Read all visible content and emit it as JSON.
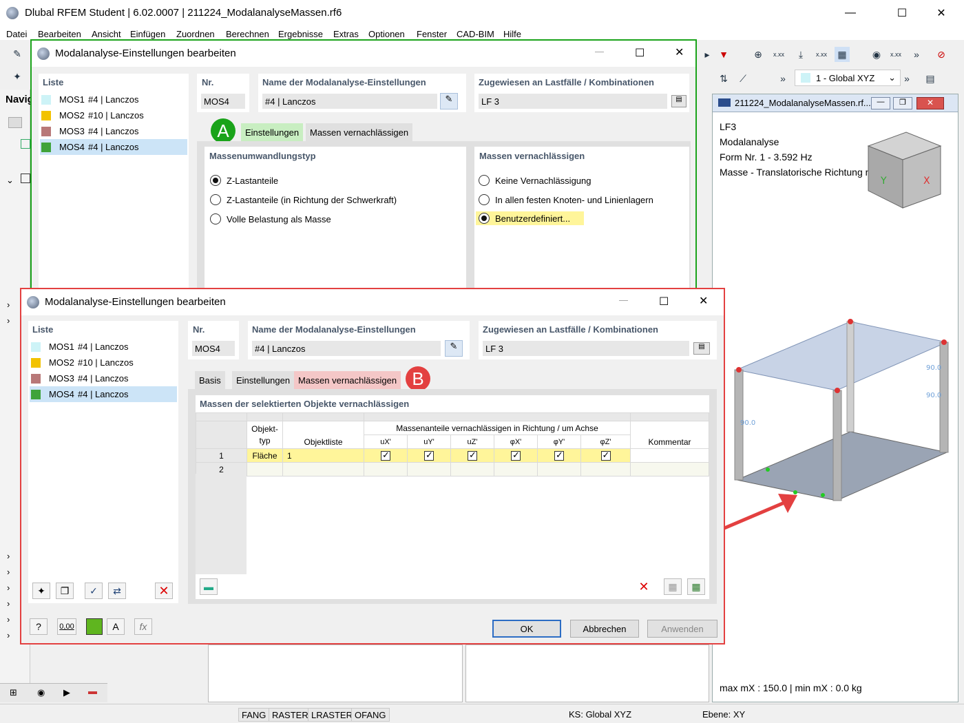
{
  "app": {
    "title": "Dlubal RFEM Student | 6.02.0007 | 211224_ModalanalyseMassen.rf6",
    "menu": [
      "Datei",
      "Bearbeiten",
      "Ansicht",
      "Einfügen",
      "Zuordnen",
      "Berechnen",
      "Ergebnisse",
      "Extras",
      "Optionen",
      "Fenster",
      "CAD-BIM",
      "Hilfe"
    ],
    "nav_label": "Navig",
    "coord_system": "1 - Global XYZ"
  },
  "viewport": {
    "title": "211224_ModalanalyseMassen.rf...",
    "info": [
      "LF3",
      "Modalanalyse",
      "Form Nr. 1 - 3.592 Hz",
      "Masse - Translatorische Richtung mX [kg]"
    ],
    "footer": "max mX : 150.0 | min mX : 0.0 kg",
    "label_value": "90.0"
  },
  "dialog_a": {
    "title": "Modalanalyse-Einstellungen bearbeiten",
    "list_header": "Liste",
    "nr_header": "Nr.",
    "nr_value": "MOS4",
    "name_header": "Name der Modalanalyse-Einstellungen",
    "name_value": "#4 | Lanczos",
    "assigned_header": "Zugewiesen an Lastfälle / Kombinationen",
    "assigned_value": "LF 3",
    "badge": "A",
    "tabs": [
      "Einstellungen",
      "Massen vernachlässigen"
    ],
    "conversion_header": "Massenumwandlungstyp",
    "conversion_options": [
      "Z-Lastanteile",
      "Z-Lastanteile (in Richtung der Schwerkraft)",
      "Volle Belastung als Masse"
    ],
    "neglect_header": "Massen vernachlässigen",
    "neglect_options": [
      "Keine Vernachlässigung",
      "In allen festen Knoten- und Linienlagern",
      "Benutzerdefiniert..."
    ]
  },
  "list_items": [
    {
      "id": "MOS1",
      "name": "#4 | Lanczos",
      "color": "#cdf3f7"
    },
    {
      "id": "MOS2",
      "name": "#10 | Lanczos",
      "color": "#f2c200"
    },
    {
      "id": "MOS3",
      "name": "#4 | Lanczos",
      "color": "#b87878"
    },
    {
      "id": "MOS4",
      "name": "#4 | Lanczos",
      "color": "#3fa33a"
    }
  ],
  "dialog_b": {
    "title": "Modalanalyse-Einstellungen bearbeiten",
    "list_header": "Liste",
    "nr_header": "Nr.",
    "nr_value": "MOS4",
    "name_header": "Name der Modalanalyse-Einstellungen",
    "name_value": "#4 | Lanczos",
    "assigned_header": "Zugewiesen an Lastfälle / Kombinationen",
    "assigned_value": "LF 3",
    "badge": "B",
    "tabs": [
      "Basis",
      "Einstellungen",
      "Massen vernachlässigen"
    ],
    "section_header": "Massen der selektierten Objekte vernachlässigen",
    "table": {
      "col_objekttyp_1": "Objekt-",
      "col_objekttyp_2": "typ",
      "col_objektliste": "Objektliste",
      "col_group": "Massenanteile vernachlässigen in Richtung / um Achse",
      "dirs": [
        "uX'",
        "uY'",
        "uZ'",
        "φX'",
        "φY'",
        "φZ'"
      ],
      "col_kommentar": "Kommentar",
      "rows": [
        {
          "nr": "1",
          "typ": "Fläche",
          "liste": "1",
          "checks": [
            true,
            true,
            true,
            true,
            true,
            true
          ]
        },
        {
          "nr": "2",
          "typ": "",
          "liste": "",
          "checks": [
            false,
            false,
            false,
            false,
            false,
            false
          ]
        }
      ]
    },
    "ok": "OK",
    "cancel": "Abbrechen",
    "apply": "Anwenden",
    "numeric_btn": "0,00"
  },
  "status": [
    "FANG",
    "RASTER",
    "LRASTER",
    "OFANG",
    "KS: Global XYZ",
    "Ebene: XY"
  ],
  "colors": {
    "green_frame": "#1aa31a",
    "red_frame": "#e34040",
    "highlight": "#fff59a"
  }
}
